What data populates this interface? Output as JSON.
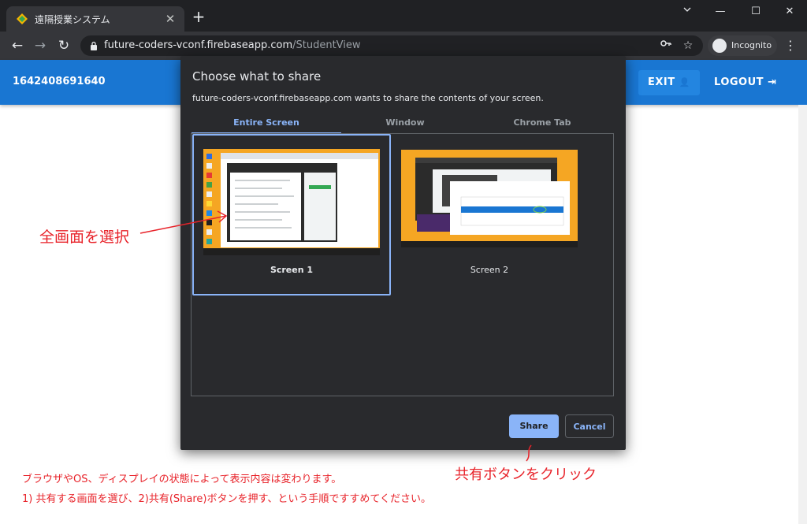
{
  "browser": {
    "tab_title": "遠隔授業システム",
    "tab_close": "✕",
    "new_tab": "+",
    "window_controls": {
      "minimize": "—",
      "maximize": "☐",
      "close": "✕"
    },
    "nav": {
      "back": "←",
      "forward": "→",
      "reload": "↻"
    },
    "url_host": "future-coders-vconf.firebaseapp.com",
    "url_path": "/StudentView",
    "key_icon": "key-icon",
    "star_icon": "star-icon",
    "incognito_label": "Incognito",
    "menu_icon": "⋮"
  },
  "app": {
    "room_id": "1642408691640",
    "exit_label": "EXIT",
    "logout_label": "LOGOUT",
    "brand_color": "#1976d2"
  },
  "dialog": {
    "title": "Choose what to share",
    "subtitle": "future-coders-vconf.firebaseapp.com wants to share the contents of your screen.",
    "tabs": [
      "Entire Screen",
      "Window",
      "Chrome Tab"
    ],
    "active_tab": "Entire Screen",
    "screens": [
      {
        "label": "Screen 1",
        "selected": true
      },
      {
        "label": "Screen 2",
        "selected": false
      }
    ],
    "share_label": "Share",
    "cancel_label": "Cancel",
    "accent_color": "#8ab4f8"
  },
  "annotations": {
    "select_entire": "全画面を選択",
    "click_share": "共有ボタンをクリック",
    "color": "#e8232a"
  },
  "notes": {
    "line1": "ブラウザやOS、ディスプレイの状態によって表示内容は変わります。",
    "line2": "1) 共有する画面を選び、2)共有(Share)ボタンを押す、という手順ですすめてください。"
  }
}
